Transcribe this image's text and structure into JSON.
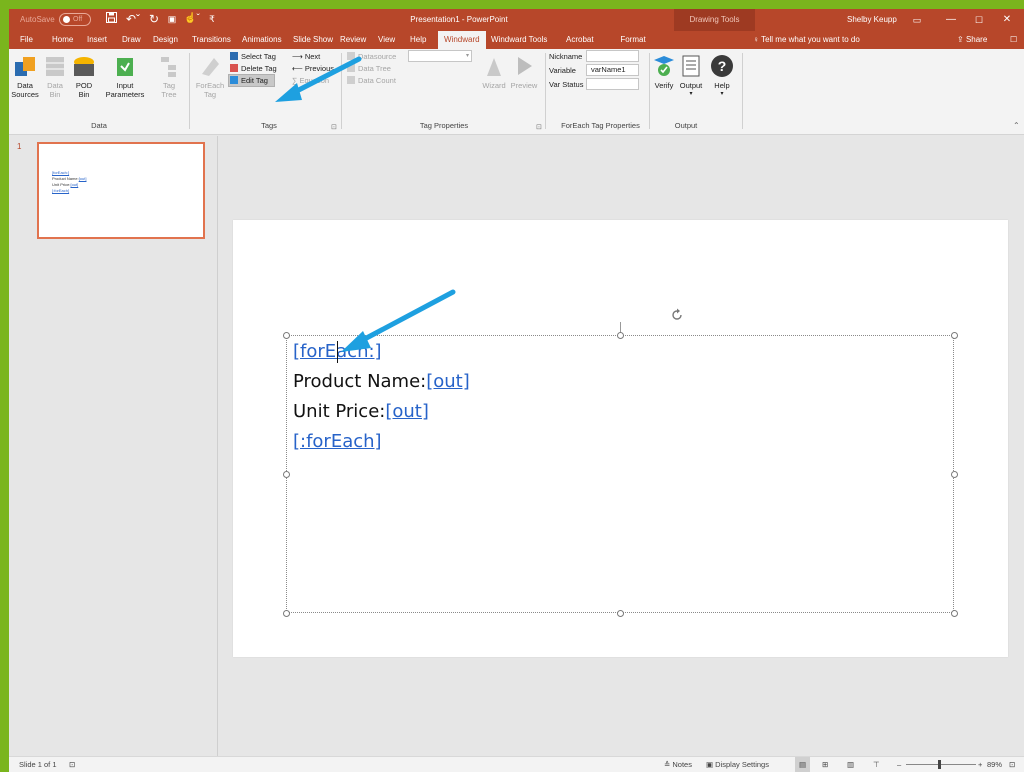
{
  "titlebar": {
    "autosave_label": "AutoSave",
    "autosave_state": "Off",
    "document_title": "Presentation1 - PowerPoint",
    "context_group": "Drawing Tools",
    "user_name": "Shelby Keupp"
  },
  "tabs": [
    {
      "label": "File"
    },
    {
      "label": "Home"
    },
    {
      "label": "Insert"
    },
    {
      "label": "Draw"
    },
    {
      "label": "Design"
    },
    {
      "label": "Transitions"
    },
    {
      "label": "Animations"
    },
    {
      "label": "Slide Show"
    },
    {
      "label": "Review"
    },
    {
      "label": "View"
    },
    {
      "label": "Help"
    },
    {
      "label": "Windward"
    },
    {
      "label": "Windward Tools"
    },
    {
      "label": "Acrobat"
    },
    {
      "label": "Format"
    }
  ],
  "active_tab": "Windward",
  "tell_me": "Tell me what you want to do",
  "share_label": "Share",
  "ribbon": {
    "data_group": {
      "label": "Data",
      "data_sources": "Data Sources",
      "data_bin": "Data Bin",
      "pod_bin": "POD Bin",
      "input_parameters": "Input Parameters",
      "tag_tree": "Tag Tree"
    },
    "tags_group": {
      "label": "Tags",
      "foreach_tag": "ForEach Tag",
      "select_tag": "Select Tag",
      "delete_tag": "Delete Tag",
      "edit_tag": "Edit Tag",
      "next": "Next",
      "previous": "Previous",
      "equation": "Equation"
    },
    "tag_properties_group": {
      "label": "Tag Properties",
      "datasource": "Datasource",
      "data_tree": "Data Tree",
      "data_count": "Data Count",
      "wizard": "Wizard",
      "preview": "Preview"
    },
    "foreach_props_group": {
      "label": "ForEach Tag Properties",
      "nickname_label": "Nickname",
      "nickname_value": "",
      "variable_label": "Variable",
      "variable_value": "varName1",
      "var_status_label": "Var Status",
      "var_status_value": ""
    },
    "output_group": {
      "label": "Output",
      "verify": "Verify",
      "output": "Output",
      "help": "Help"
    }
  },
  "thumbnail": {
    "number": "1",
    "lines": [
      "[forEach:]",
      "Product Name:",
      "[out]",
      "Unit Price:",
      "[out]",
      "[:forEach]"
    ]
  },
  "slide": {
    "line1_tag": "[forEach:]",
    "line2_text": "Product Name:",
    "line2_tag": "[out]",
    "line3_text": "Unit Price:",
    "line3_tag": "[out]",
    "line4_tag": "[:forEach]"
  },
  "statusbar": {
    "slide_info": "Slide 1 of 1",
    "notes": "Notes",
    "display_settings": "Display Settings",
    "zoom": "89%"
  },
  "colors": {
    "accent": "#b7472a",
    "frame": "#7ab51d",
    "link": "#2763c9",
    "callout_arrow": "#1ea0e0"
  }
}
